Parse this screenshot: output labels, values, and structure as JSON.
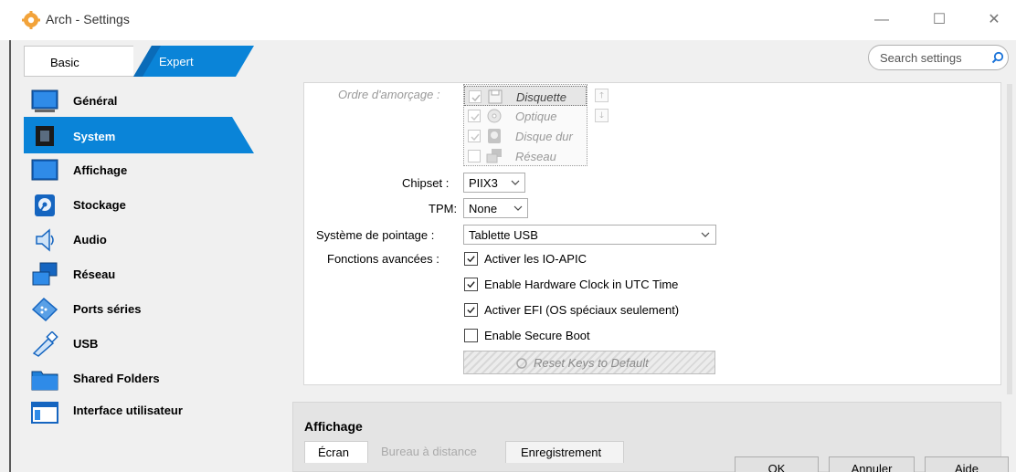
{
  "window": {
    "title": "Arch - Settings",
    "minimize": "—",
    "maximize": "☐",
    "close": "✕"
  },
  "mode": {
    "basic": "Basic",
    "expert": "Expert",
    "active": "Expert"
  },
  "search": {
    "placeholder": "Search settings"
  },
  "sidebar": {
    "items": [
      {
        "label": "Général",
        "icon": "general-icon"
      },
      {
        "label": "System",
        "icon": "system-icon",
        "active": true
      },
      {
        "label": "Affichage",
        "icon": "display-icon"
      },
      {
        "label": "Stockage",
        "icon": "storage-icon"
      },
      {
        "label": "Audio",
        "icon": "audio-icon"
      },
      {
        "label": "Réseau",
        "icon": "network-icon"
      },
      {
        "label": "Ports séries",
        "icon": "serial-ports-icon"
      },
      {
        "label": "USB",
        "icon": "usb-icon"
      },
      {
        "label": "Shared Folders",
        "icon": "shared-folders-icon"
      },
      {
        "label": "Interface utilisateur",
        "icon": "user-interface-icon"
      }
    ]
  },
  "system": {
    "boot_order": {
      "label": "Ordre d'amorçage :",
      "items": [
        {
          "label": "Disquette",
          "checked": true,
          "selected": true
        },
        {
          "label": "Optique",
          "checked": true
        },
        {
          "label": "Disque dur",
          "checked": true
        },
        {
          "label": "Réseau",
          "checked": false
        }
      ],
      "move_up": "🡑",
      "move_down": "🡓"
    },
    "chipset": {
      "label": "Chipset :",
      "value": "PIIX3"
    },
    "tpm": {
      "label": "TPM:",
      "value": "None"
    },
    "pointing": {
      "label": "Système de pointage :",
      "value": "Tablette USB"
    },
    "advanced": {
      "label": "Fonctions avancées :",
      "options": [
        {
          "label": "Activer les IO-APIC",
          "checked": true
        },
        {
          "label": "Enable Hardware Clock in UTC Time",
          "checked": true
        },
        {
          "label": "Activer EFI (OS spéciaux seulement)",
          "checked": true
        },
        {
          "label": "Enable Secure Boot",
          "checked": false
        }
      ]
    },
    "reset_keys": "Reset Keys to Default"
  },
  "display_section": {
    "title": "Affichage",
    "tabs": [
      "Écran",
      "Bureau à distance",
      "Enregistrement"
    ]
  },
  "buttons": {
    "ok": "OK",
    "cancel": "Annuler",
    "help": "Aide"
  },
  "colors": {
    "accent": "#0a84d8",
    "accent_dark": "#0a6bb8"
  }
}
